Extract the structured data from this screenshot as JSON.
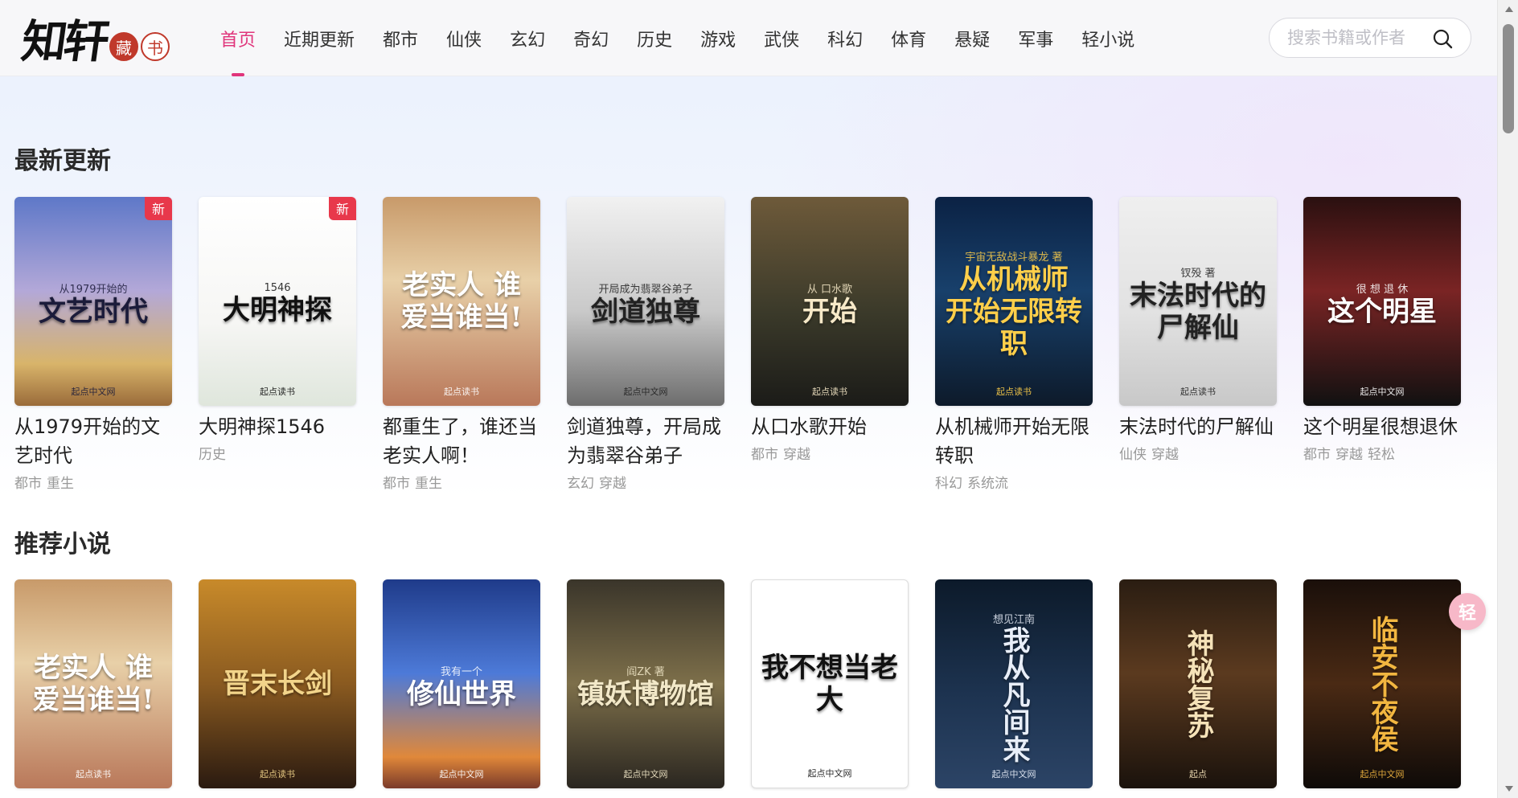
{
  "header": {
    "logo_text": "知轩",
    "logo_seal_1": "藏",
    "logo_seal_2": "书",
    "nav": [
      {
        "label": "首页",
        "active": true
      },
      {
        "label": "近期更新"
      },
      {
        "label": "都市"
      },
      {
        "label": "仙侠"
      },
      {
        "label": "玄幻"
      },
      {
        "label": "奇幻"
      },
      {
        "label": "历史"
      },
      {
        "label": "游戏"
      },
      {
        "label": "武侠"
      },
      {
        "label": "科幻"
      },
      {
        "label": "体育"
      },
      {
        "label": "悬疑"
      },
      {
        "label": "军事"
      },
      {
        "label": "轻小说"
      }
    ],
    "search_placeholder": "搜索书籍或作者",
    "search_icon": "search-icon"
  },
  "latest": {
    "title": "最新更新",
    "books": [
      {
        "title": "从1979开始的文艺时代",
        "tags": [
          "都市",
          "重生"
        ],
        "is_new": true,
        "new_label": "新",
        "cover_text": "文艺时代",
        "cover_sub": "从1979开始的",
        "cover_pub": "起点中文网"
      },
      {
        "title": "大明神探1546",
        "tags": [
          "历史"
        ],
        "is_new": true,
        "new_label": "新",
        "cover_text": "大明神探",
        "cover_sub": "1546",
        "cover_pub": "起点读书"
      },
      {
        "title": "都重生了，谁还当老实人啊！",
        "tags": [
          "都市",
          "重生"
        ],
        "cover_text": "老实人 谁爱当谁当!",
        "cover_sub": "",
        "cover_pub": "起点读书"
      },
      {
        "title": "剑道独尊，开局成为翡翠谷弟子",
        "tags": [
          "玄幻",
          "穿越"
        ],
        "cover_text": "剑道独尊",
        "cover_sub": "开局成为翡翠谷弟子",
        "cover_pub": "起点中文网"
      },
      {
        "title": "从口水歌开始",
        "tags": [
          "都市",
          "穿越"
        ],
        "cover_text": "开始",
        "cover_sub": "从 口水歌",
        "cover_pub": "起点读书"
      },
      {
        "title": "从机械师开始无限转职",
        "tags": [
          "科幻",
          "系统流"
        ],
        "cover_text": "从机械师 开始无限转职",
        "cover_sub": "宇宙无敌战斗暴龙 著",
        "cover_pub": "起点读书"
      },
      {
        "title": "末法时代的尸解仙",
        "tags": [
          "仙侠",
          "穿越"
        ],
        "cover_text": "末法时代的尸解仙",
        "cover_sub": "钗殁 著",
        "cover_pub": "起点读书"
      },
      {
        "title": "这个明星很想退休",
        "tags": [
          "都市",
          "穿越",
          "轻松"
        ],
        "cover_text": "这个明星",
        "cover_sub": "很 想 退 休",
        "cover_pub": "起点中文网"
      }
    ]
  },
  "recommended": {
    "title": "推荐小说",
    "books": [
      {
        "cover_text": "老实人 谁爱当谁当!",
        "cover_pub": "起点读书",
        "vertical": false
      },
      {
        "cover_text": "晋末长剑",
        "cover_pub": "起点读书",
        "vertical": false
      },
      {
        "cover_text": "修仙世界",
        "cover_sub": "我有一个",
        "cover_pub": "起点中文网",
        "vertical": false
      },
      {
        "cover_text": "镇妖博物馆",
        "cover_sub": "阎ZK 著",
        "cover_pub": "起点中文网",
        "vertical": false
      },
      {
        "cover_text": "我不想当老大",
        "cover_pub": "起点中文网",
        "vertical": false
      },
      {
        "cover_text": "我从凡间来",
        "cover_sub": "想见江南",
        "cover_pub": "起点中文网",
        "vertical": true
      },
      {
        "cover_text": "神秘复苏",
        "cover_pub": "起点",
        "vertical": true
      },
      {
        "cover_text": "临安不夜侯",
        "cover_pub": "起点中文网",
        "vertical": true
      }
    ]
  },
  "float_button_label": "轻"
}
